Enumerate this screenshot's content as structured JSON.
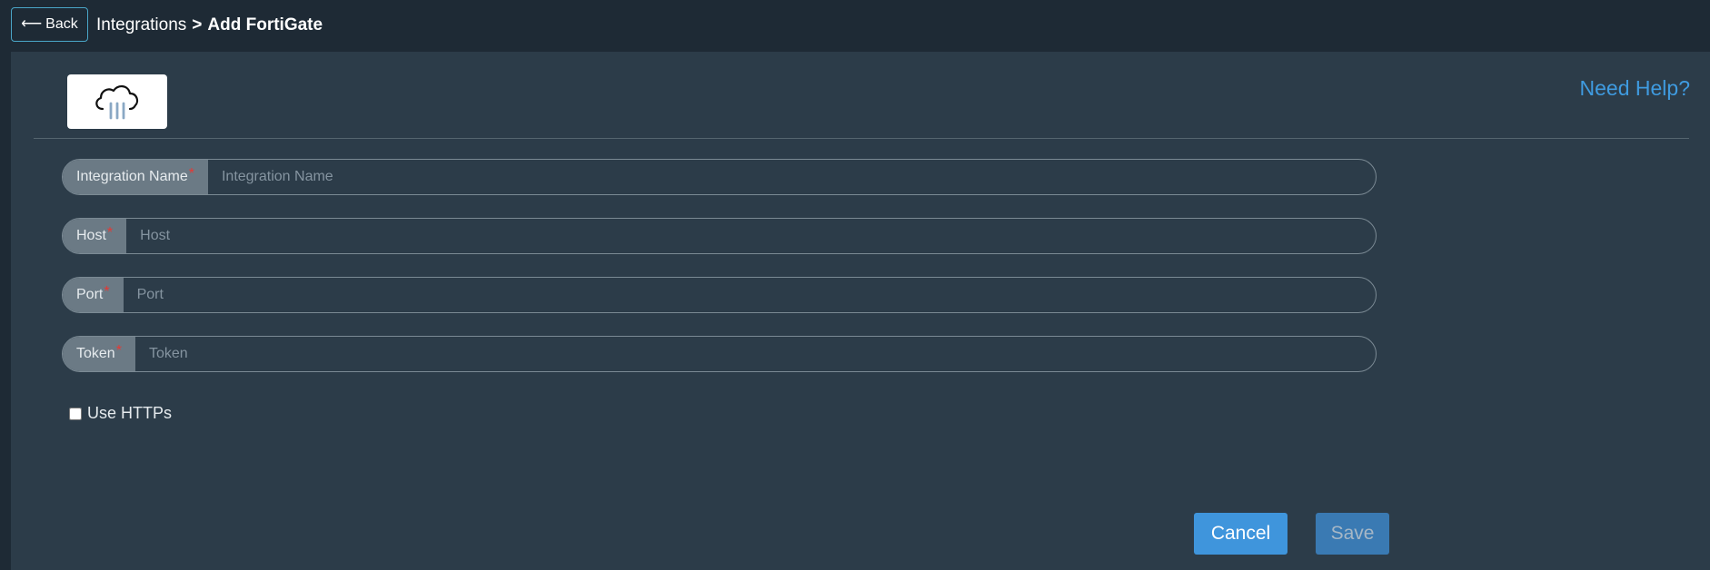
{
  "header": {
    "back_label": "Back",
    "breadcrumb_parent": "Integrations",
    "breadcrumb_separator": ">",
    "breadcrumb_current": "Add FortiGate"
  },
  "panel": {
    "logo_icon": "cloud-icon",
    "help_link": "Need Help?"
  },
  "form": {
    "fields": [
      {
        "label": "Integration Name",
        "required_mark": "*",
        "placeholder": "Integration Name",
        "value": ""
      },
      {
        "label": "Host",
        "required_mark": "*",
        "placeholder": "Host",
        "value": ""
      },
      {
        "label": "Port",
        "required_mark": "*",
        "placeholder": "Port",
        "value": ""
      },
      {
        "label": "Token",
        "required_mark": "*",
        "placeholder": "Token",
        "value": ""
      }
    ],
    "use_https_label": "Use HTTPs",
    "use_https_checked": false
  },
  "actions": {
    "cancel_label": "Cancel",
    "save_label": "Save"
  },
  "colors": {
    "accent": "#3f95dc",
    "required": "#e53935",
    "panel_bg": "#2c3c49",
    "page_bg": "#1e2a35"
  }
}
